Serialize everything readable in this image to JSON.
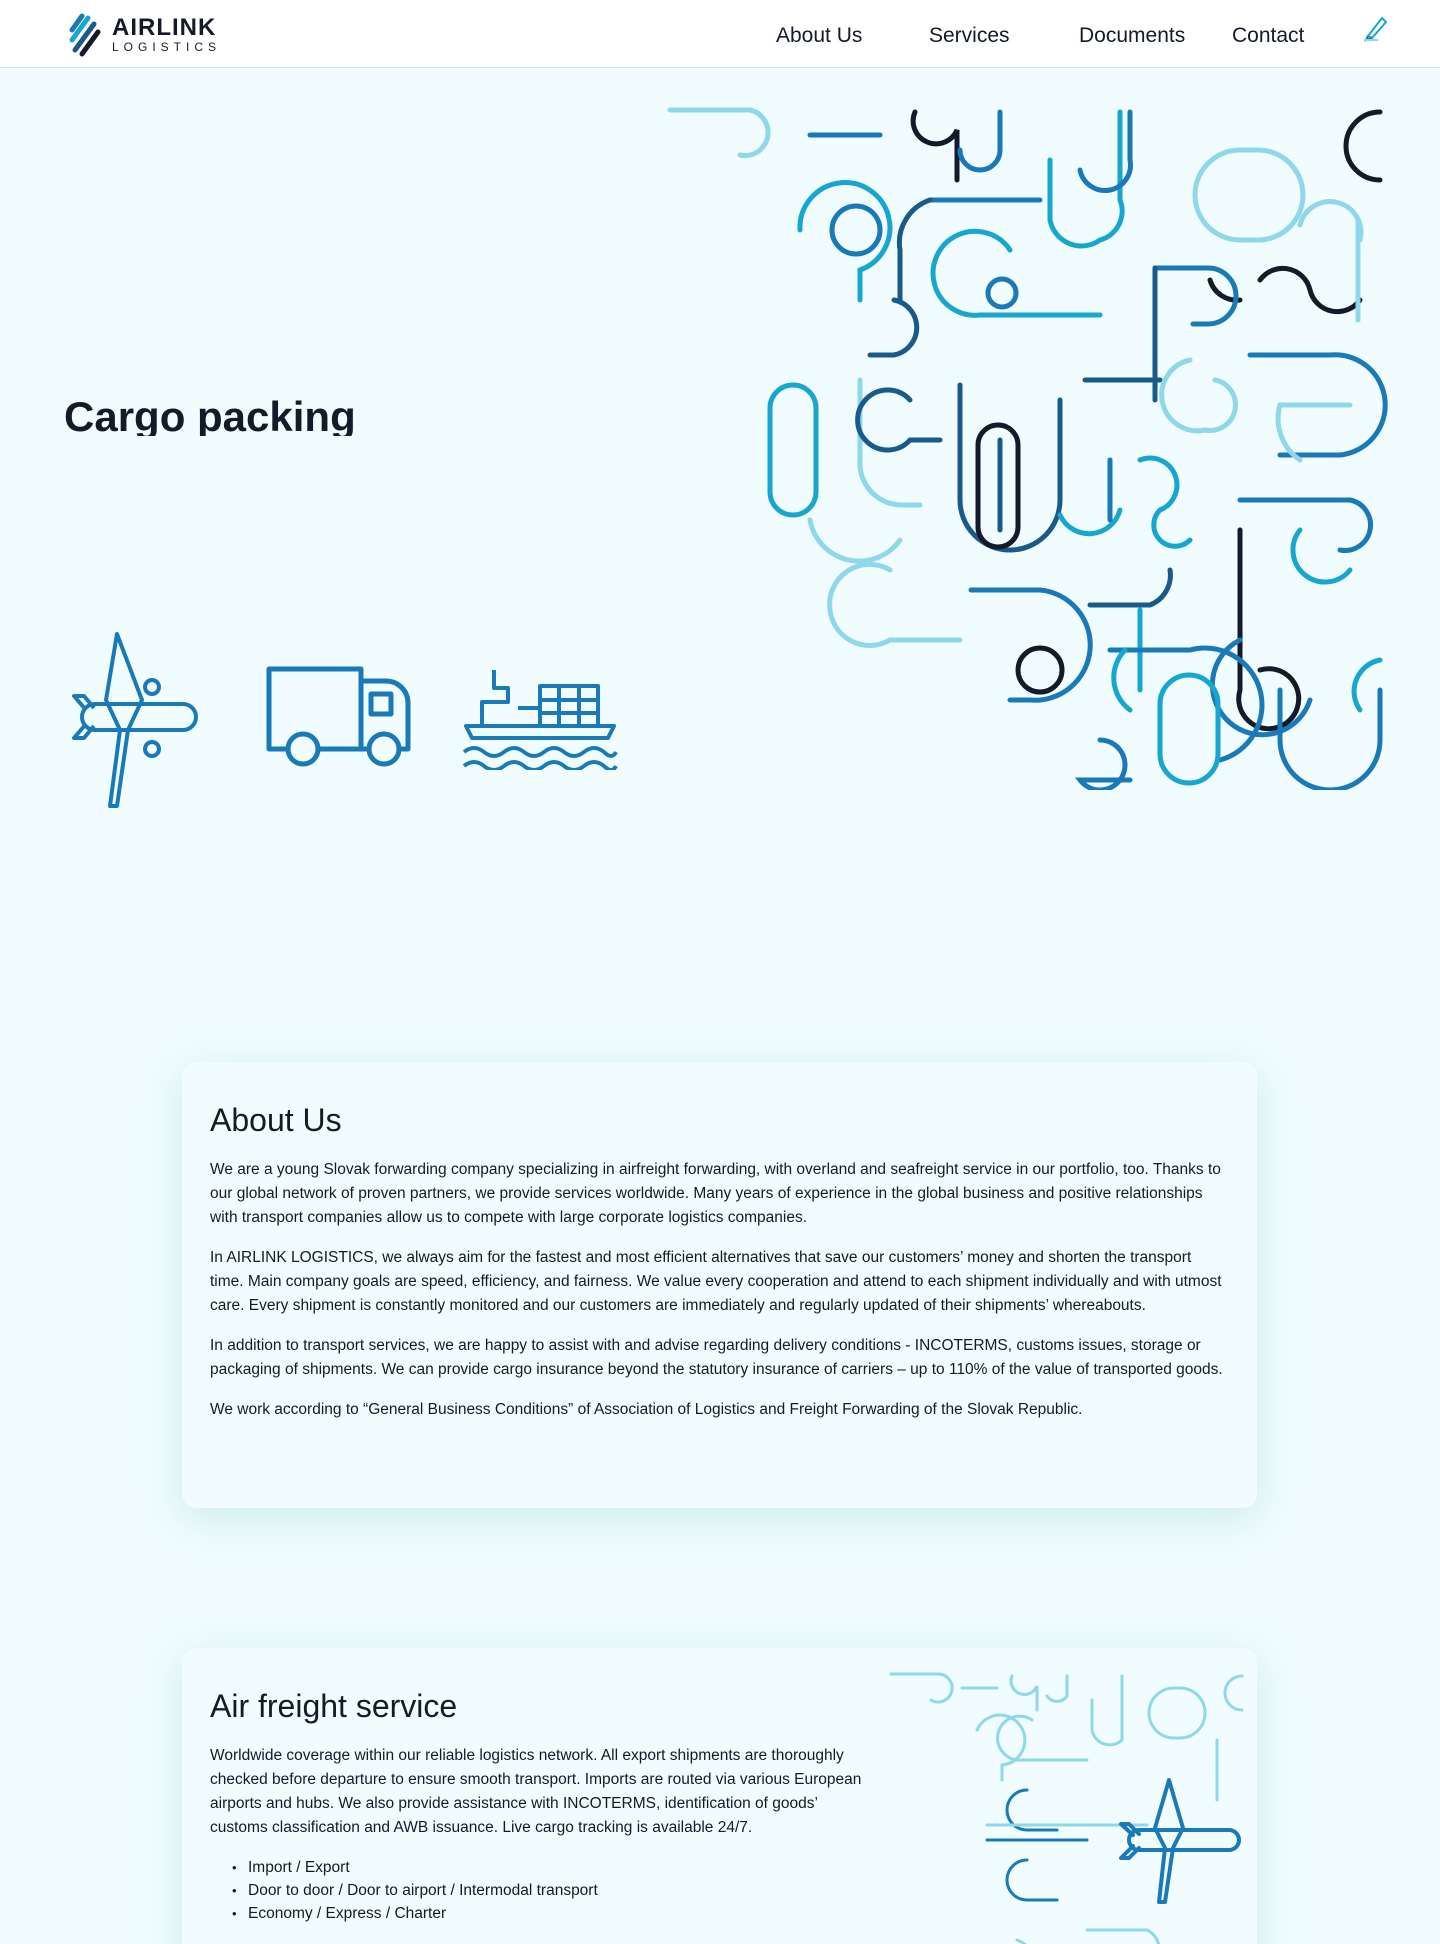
{
  "header": {
    "logo_main": "AIRLINK",
    "logo_sub": "LOGISTICS",
    "nav": [
      "About Us",
      "Services",
      "Documents",
      "Contact"
    ],
    "edit_icon": "pen-icon"
  },
  "hero": {
    "title": "Cargo packing",
    "icons": [
      "airplane-icon",
      "truck-icon",
      "ship-icon"
    ]
  },
  "about": {
    "title": "About Us",
    "paragraphs": [
      "We are a young Slovak forwarding company specializing in airfreight forwarding, with overland and seafreight service in our portfolio, too. Thanks to our global network of proven partners, we provide services worldwide. Many years of experience in the global business and positive relationships with transport companies allow us to compete with large corporate logistics companies.",
      "In AIRLINK LOGISTICS, we always aim for the fastest and most efficient alternatives that save our customers’ money and shorten the transport time. Main company goals are speed, efficiency, and fairness. We value every cooperation and attend to each shipment individually and with utmost care. Every shipment is constantly monitored and our customers are immediately and regularly updated of their shipments’ whereabouts.",
      "In addition to transport services, we are happy to assist with and advise regarding delivery conditions - INCOTERMS, customs issues, storage or packaging of shipments. We can provide cargo insurance beyond the statutory insurance of carriers – up to 110% of the value of transported goods.",
      "We work according to “General Business Conditions” of Association of Logistics and Freight Forwarding of the Slovak Republic."
    ]
  },
  "air": {
    "title": "Air freight service",
    "text": "Worldwide coverage within our reliable logistics network. All export shipments are thoroughly checked before departure to ensure smooth transport. Imports are routed via various European airports and hubs. We also provide assistance with INCOTERMS, identification of goods’ customs classification and AWB issuance. Live cargo tracking is available 24/7.",
    "list": [
      "Import / Export",
      "Door to door / Door to airport / Intermodal transport",
      "Economy / Express / Charter"
    ]
  },
  "colors": {
    "background": "#f0fcfd",
    "dark": "#141a2a",
    "blue": "#1a7ab8",
    "cyan": "#16a6d0",
    "light": "#8fd7ea"
  }
}
